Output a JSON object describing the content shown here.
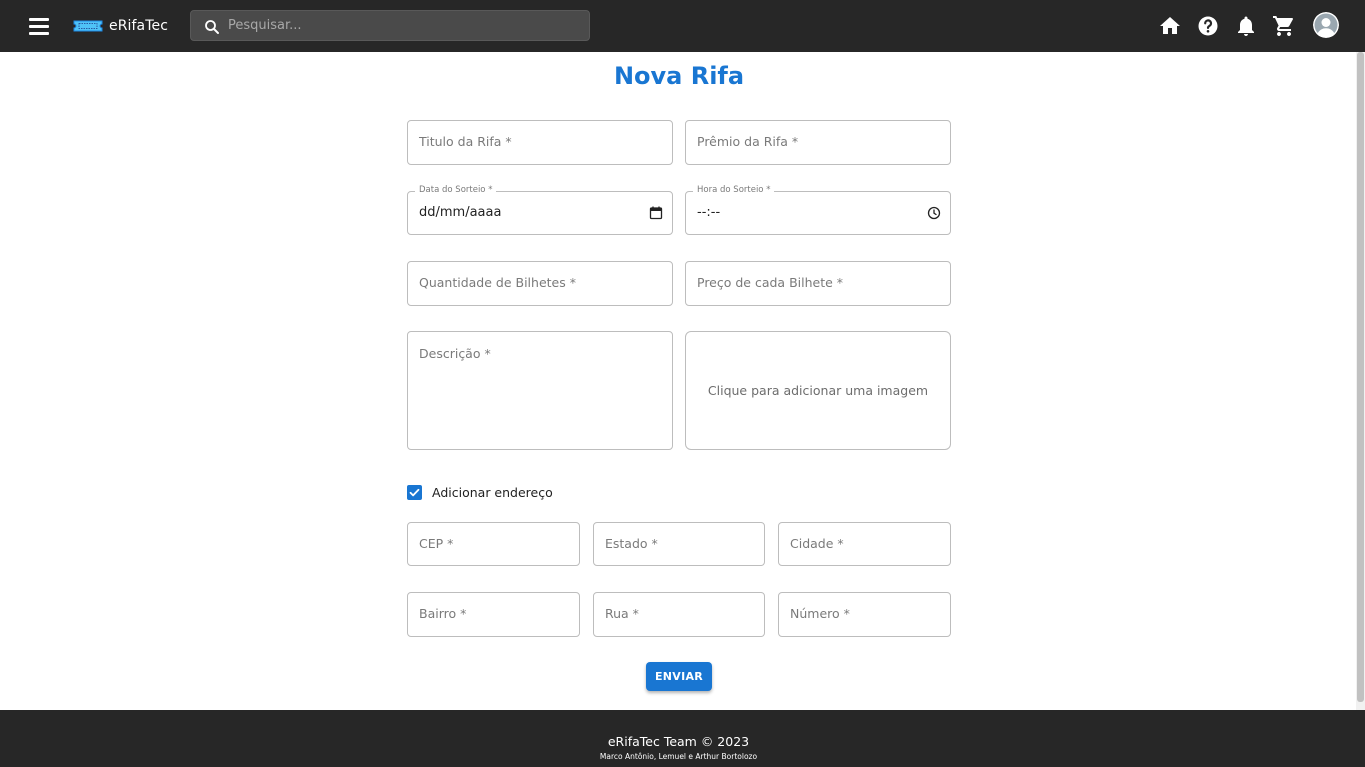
{
  "header": {
    "brand": "eRifaTec",
    "search_placeholder": "Pesquisar...",
    "icons": [
      "menu-icon",
      "home-icon",
      "help-icon",
      "notifications-icon",
      "cart-icon",
      "account-icon"
    ]
  },
  "page": {
    "title": "Nova Rifa"
  },
  "form": {
    "titulo_label": "Titulo da Rifa *",
    "premio_label": "Prêmio da Rifa *",
    "data_label": "Data do Sorteio *",
    "data_value": "dd/mm/aaaa",
    "hora_label": "Hora do Sorteio *",
    "hora_value": "--:--",
    "quantidade_label": "Quantidade de Bilhetes *",
    "preco_label": "Preço de cada Bilhete *",
    "descricao_label": "Descrição *",
    "imagem_label": "Clique para adicionar uma imagem",
    "endereco_checkbox_label": "Adicionar endereço",
    "endereco_checked": true,
    "cep_label": "CEP *",
    "estado_label": "Estado *",
    "cidade_label": "Cidade *",
    "bairro_label": "Bairro *",
    "rua_label": "Rua *",
    "numero_label": "Número *",
    "submit_label": "ENVIAR"
  },
  "footer": {
    "title": "eRifaTec Team © 2023",
    "authors": "Marco Antônio, Lemuel e Arthur Bortolozo"
  },
  "colors": {
    "accent": "#1976d2",
    "bar": "#272727"
  }
}
